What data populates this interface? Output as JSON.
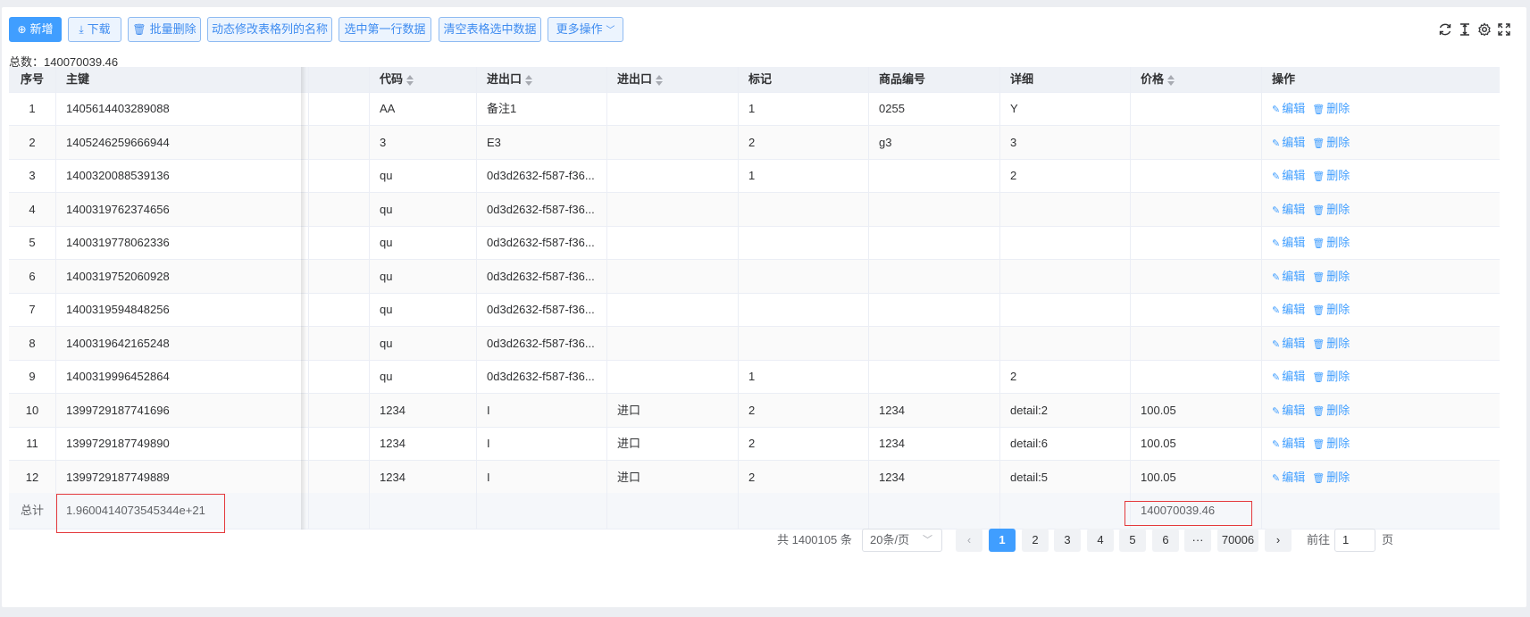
{
  "toolbar": {
    "add": "新增",
    "download": "下载",
    "batch_delete": "批量删除",
    "rename_col": "动态修改表格列的名称",
    "select_first": "选中第一行数据",
    "clear_selection": "清空表格选中数据",
    "more": "更多操作",
    "icons": [
      "refresh-icon",
      "column-height-icon",
      "settings-icon",
      "fullscreen-icon"
    ]
  },
  "total_line": "总数：140070039.46",
  "columns": [
    "序号",
    "主键",
    "代码",
    "进出口",
    "进出口",
    "标记",
    "商品编号",
    "详细",
    "价格",
    "操作"
  ],
  "rows": [
    {
      "idx": "1",
      "key": "1405614403289088",
      "code": "AA",
      "io1": "备注1",
      "io2": "",
      "mark": "1",
      "goods": "0255",
      "detail": "Y",
      "price": ""
    },
    {
      "idx": "2",
      "key": "1405246259666944",
      "code": "3",
      "io1": "E3",
      "io2": "",
      "mark": "2",
      "goods": "g3",
      "detail": "3",
      "price": ""
    },
    {
      "idx": "3",
      "key": "1400320088539136",
      "code": "qu",
      "io1": "0d3d2632-f587-f36...",
      "io2": "",
      "mark": "1",
      "goods": "",
      "detail": "2",
      "price": ""
    },
    {
      "idx": "4",
      "key": "1400319762374656",
      "code": "qu",
      "io1": "0d3d2632-f587-f36...",
      "io2": "",
      "mark": "",
      "goods": "",
      "detail": "",
      "price": ""
    },
    {
      "idx": "5",
      "key": "1400319778062336",
      "code": "qu",
      "io1": "0d3d2632-f587-f36...",
      "io2": "",
      "mark": "",
      "goods": "",
      "detail": "",
      "price": ""
    },
    {
      "idx": "6",
      "key": "1400319752060928",
      "code": "qu",
      "io1": "0d3d2632-f587-f36...",
      "io2": "",
      "mark": "",
      "goods": "",
      "detail": "",
      "price": ""
    },
    {
      "idx": "7",
      "key": "1400319594848256",
      "code": "qu",
      "io1": "0d3d2632-f587-f36...",
      "io2": "",
      "mark": "",
      "goods": "",
      "detail": "",
      "price": ""
    },
    {
      "idx": "8",
      "key": "1400319642165248",
      "code": "qu",
      "io1": "0d3d2632-f587-f36...",
      "io2": "",
      "mark": "",
      "goods": "",
      "detail": "",
      "price": ""
    },
    {
      "idx": "9",
      "key": "1400319996452864",
      "code": "qu",
      "io1": "0d3d2632-f587-f36...",
      "io2": "",
      "mark": "1",
      "goods": "",
      "detail": "2",
      "price": ""
    },
    {
      "idx": "10",
      "key": "1399729187741696",
      "code": "1234",
      "io1": "I",
      "io2": "进口",
      "mark": "2",
      "goods": "1234",
      "detail": "detail:2",
      "price": "100.05"
    },
    {
      "idx": "11",
      "key": "1399729187749890",
      "code": "1234",
      "io1": "I",
      "io2": "进口",
      "mark": "2",
      "goods": "1234",
      "detail": "detail:6",
      "price": "100.05"
    },
    {
      "idx": "12",
      "key": "1399729187749889",
      "code": "1234",
      "io1": "I",
      "io2": "进口",
      "mark": "2",
      "goods": "1234",
      "detail": "detail:5",
      "price": "100.05"
    }
  ],
  "row_actions": {
    "edit": "编辑",
    "delete": "删除"
  },
  "summary": {
    "label": "总计",
    "key_sum": "1.9600414073545344e+21",
    "price_sum": "140070039.46"
  },
  "pagination": {
    "total": "共 1400105 条",
    "page_size": "20条/页",
    "pages": [
      "1",
      "2",
      "3",
      "4",
      "5",
      "6",
      "···",
      "70006"
    ],
    "current": "1",
    "goto_label": "前往",
    "goto_value": "1",
    "goto_unit": "页"
  },
  "colors": {
    "primary": "#409eff",
    "highlight_box": "#e4393c"
  }
}
